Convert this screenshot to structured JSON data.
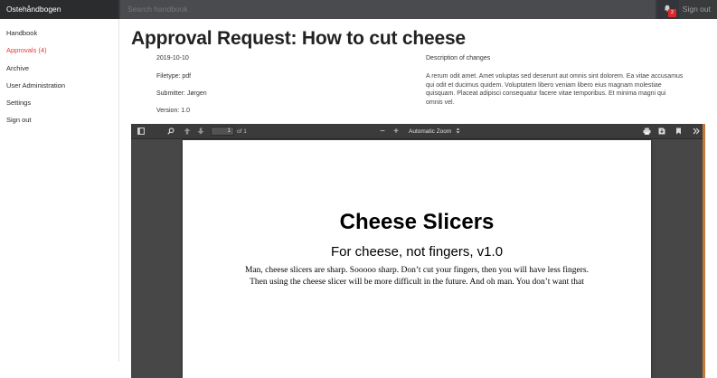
{
  "app": {
    "brand": "Ostehåndbogen"
  },
  "search": {
    "placeholder": "Search handbook"
  },
  "notifications": {
    "count": "2"
  },
  "header": {
    "signout": "Sign out"
  },
  "sidebar": {
    "items": [
      {
        "label": "Handbook"
      },
      {
        "label": "Approvals (4)"
      },
      {
        "label": "Archive"
      },
      {
        "label": "User Administration"
      },
      {
        "label": "Settings"
      },
      {
        "label": "Sign out"
      }
    ]
  },
  "page": {
    "title": "Approval Request: How to cut cheese",
    "meta": {
      "date": "2019-10-10",
      "filetype": "Filetype: pdf",
      "submitter": "Submitter: Jørgen",
      "version": "Version: 1.0"
    },
    "description_label": "Description of changes",
    "description": "A rerum odit amet. Amet voluptas sed deserunt aut omnis sint dolorem. Ea vitae accusamus qui odit et ducimus quidem. Voluptatem libero veniam libero eius magnam molestiae quisquam. Placeat adipisci consequatur facere vitae temporibus. Et minima magni qui omnis vel."
  },
  "viewer": {
    "page_number": "1",
    "page_of": "of 1",
    "zoom": "Automatic Zoom",
    "zoom_out": "−",
    "zoom_in": "+"
  },
  "document": {
    "title": "Cheese Slicers",
    "subtitle": "For cheese, not fingers, v1.0",
    "line1": "Man, cheese slicers are sharp. Sooooo sharp. Don’t cut your fingers, then you will have less fingers.",
    "line2": "Then using the cheese slicer will be more difficult in the future. And oh man. You don’t want that"
  },
  "colors": {
    "accent": "#e53935",
    "topbar": "#3a3b3d",
    "viewer_bg": "#474747",
    "scrollbar": "#c07a36"
  }
}
